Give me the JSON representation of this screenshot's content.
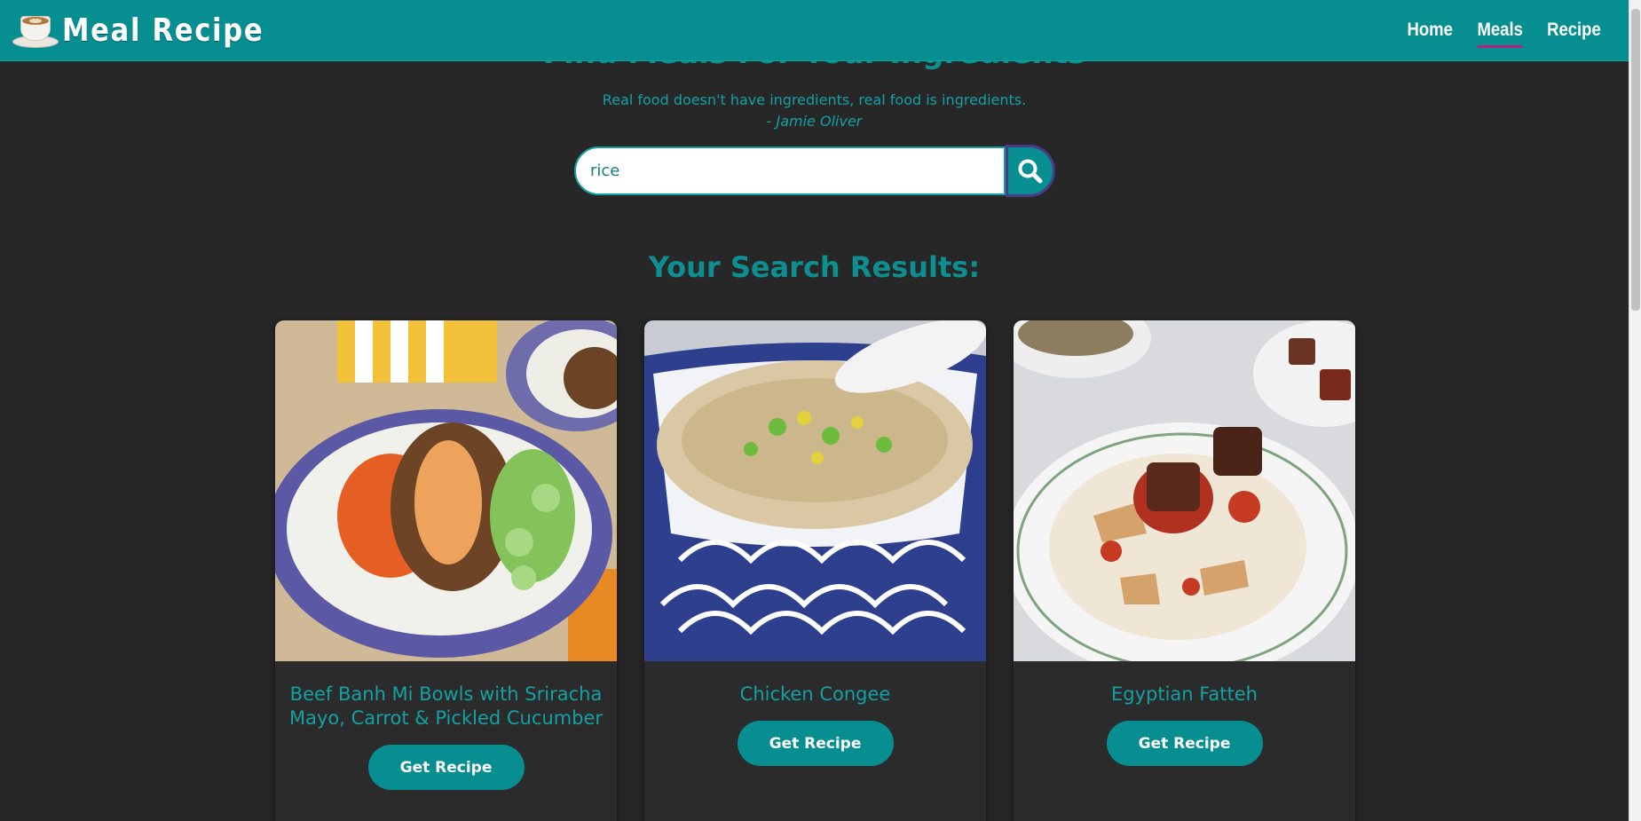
{
  "brand": {
    "title": "Meal Recipe",
    "logo_icon": "coffee-cup-icon"
  },
  "nav": {
    "items": [
      {
        "label": "Home",
        "active": false
      },
      {
        "label": "Meals",
        "active": true
      },
      {
        "label": "Recipe",
        "active": false
      }
    ],
    "active_underline_color": "#b2237e"
  },
  "hero": {
    "title": "Find Meals For Your Ingredients",
    "quote": "Real food doesn't have ingredients, real food is ingredients.",
    "author": "- Jamie Oliver"
  },
  "search": {
    "value": "rice",
    "button_icon": "search-icon"
  },
  "results": {
    "heading": "Your Search Results:",
    "cards": [
      {
        "title": "Beef Banh Mi Bowls with Sriracha Mayo, Carrot & Pickled Cucumber",
        "button": "Get Recipe",
        "image": "beef-banh-mi-bowl-photo"
      },
      {
        "title": "Chicken Congee",
        "button": "Get Recipe",
        "image": "chicken-congee-photo"
      },
      {
        "title": "Egyptian Fatteh",
        "button": "Get Recipe",
        "image": "egyptian-fatteh-photo"
      }
    ]
  },
  "colors": {
    "accent": "#078e90",
    "text_accent": "#12a1a4",
    "background": "#272727"
  }
}
